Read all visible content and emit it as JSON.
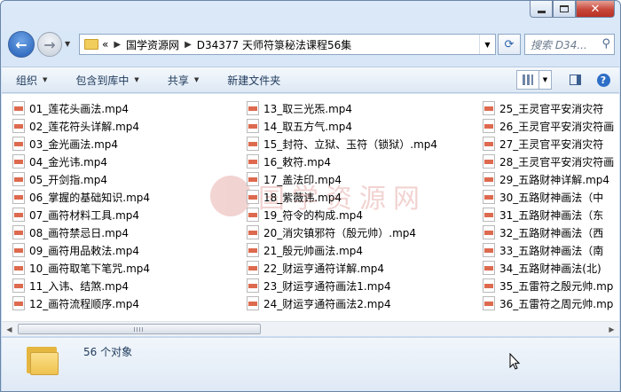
{
  "address": {
    "overflow": "«",
    "crumbs": [
      "国学资源网",
      "D34377 天师符箓秘法课程56集"
    ]
  },
  "search": {
    "placeholder": "搜索 D34..."
  },
  "toolbar": {
    "organize": "组织",
    "include_library": "包含到库中",
    "share": "共享",
    "new_folder": "新建文件夹"
  },
  "files": [
    [
      "01_莲花头画法.mp4",
      "02_莲花符头详解.mp4",
      "03_金光画法.mp4",
      "04_金光讳.mp4",
      "05_开剑指.mp4",
      "06_掌握的基础知识.mp4",
      "07_画符材料工具.mp4",
      "08_画符禁忌日.mp4",
      "09_画符用品敕法.mp4",
      "10_画符取笔下笔咒.mp4",
      "11_入讳、结煞.mp4",
      "12_画符流程顺序.mp4"
    ],
    [
      "13_取三光炁.mp4",
      "14_取五方气.mp4",
      "15_封符、立狱、玉符（锁狱）.mp4",
      "16_敕符.mp4",
      "17_盖法印.mp4",
      "18_紫薇讳.mp4",
      "19_符令的构成.mp4",
      "20_消灾镇邪符（殷元帅）.mp4",
      "21_殷元帅画法.mp4",
      "22_财运亨通符详解.mp4",
      "23_财运亨通符画法1.mp4",
      "24_财运亨通符画法2.mp4"
    ],
    [
      "25_王灵官平安消灾符",
      "26_王灵官平安消灾符画",
      "27_王灵官平安消灾符",
      "28_王灵官平安消灾符画",
      "29_五路财神详解.mp4",
      "30_五路财神画法（中",
      "31_五路财神画法（东",
      "32_五路财神画法（西",
      "33_五路财神画法（南",
      "34_五路财神画法(北)",
      "35_五雷符之殷元帅.mp",
      "36_五雷符之周元帅.mp"
    ]
  ],
  "watermark": "国学资源网",
  "status": {
    "count": "56 个对象"
  }
}
